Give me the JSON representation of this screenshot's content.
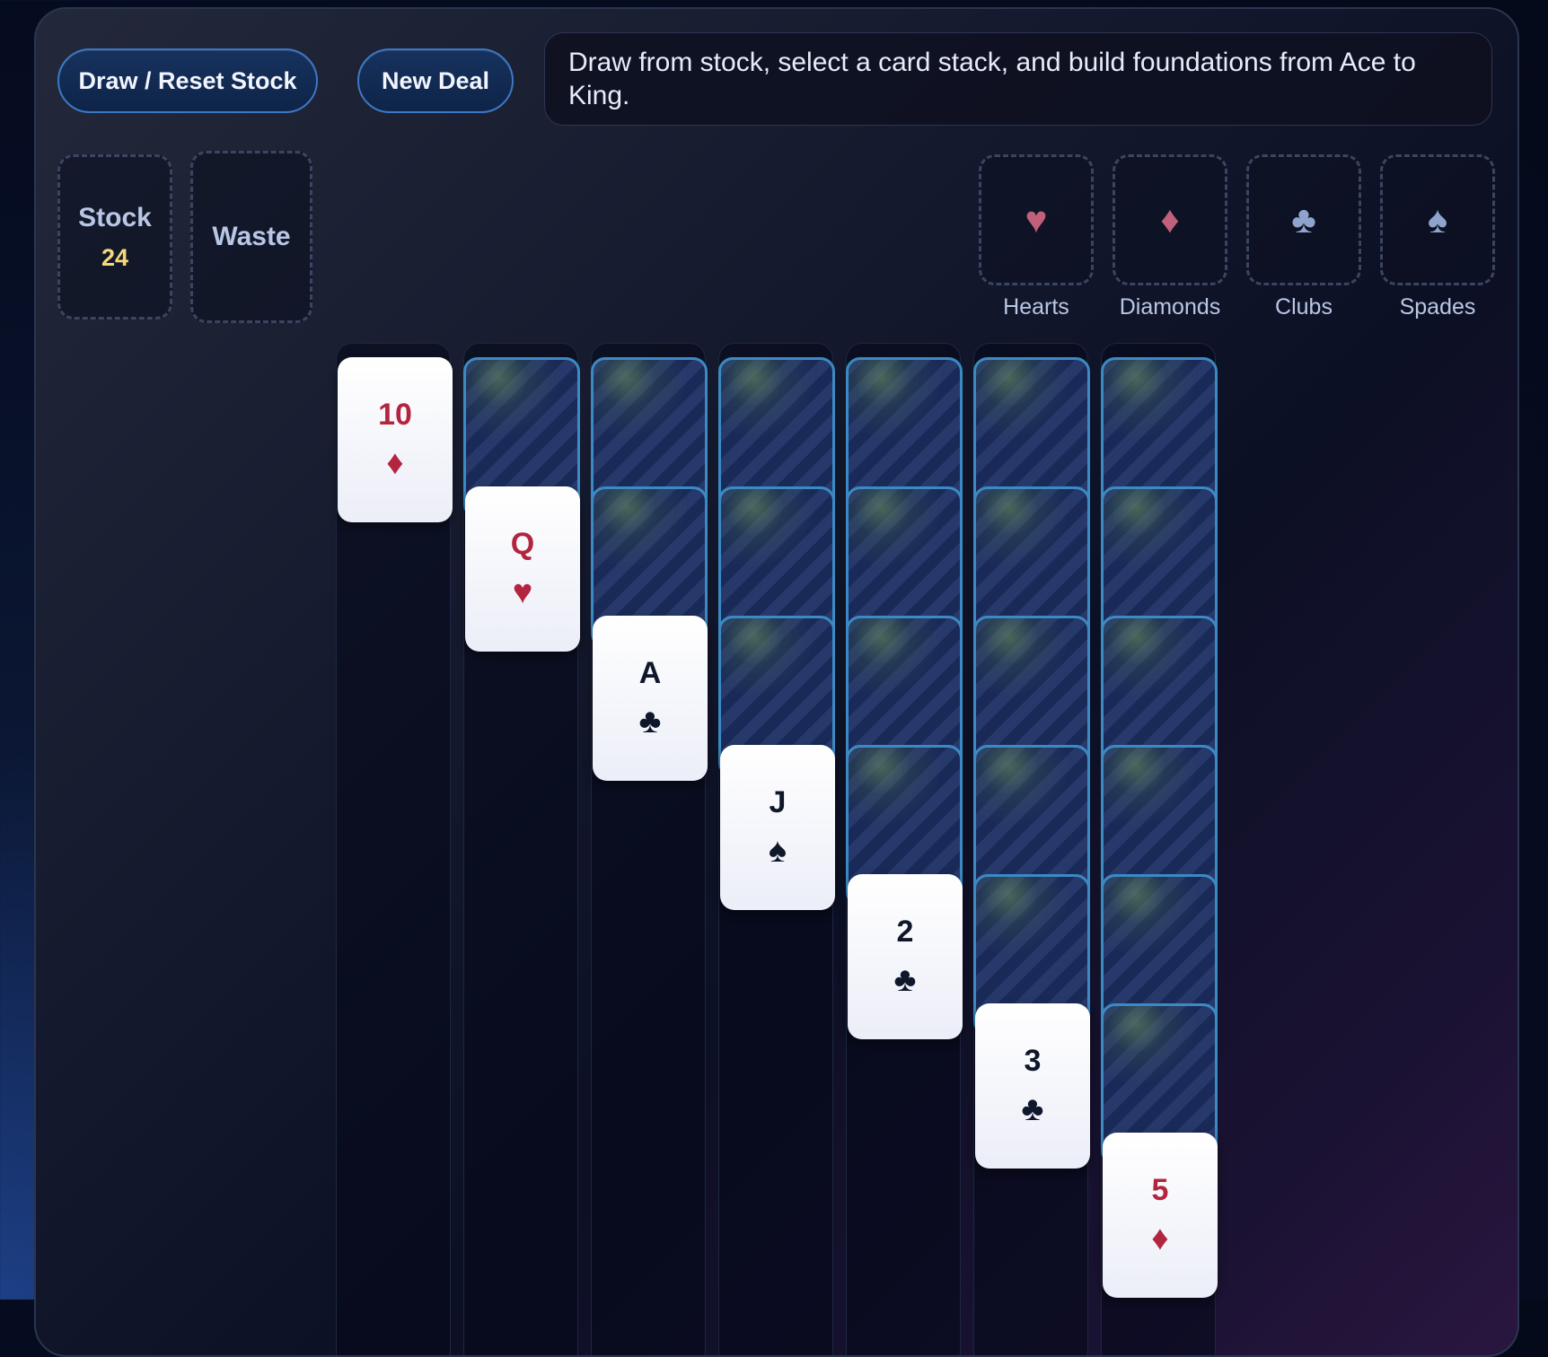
{
  "toolbar": {
    "draw_label": "Draw / Reset Stock",
    "new_deal_label": "New Deal"
  },
  "message": "Draw from stock, select a card stack, and build foundations from Ace to King.",
  "stock": {
    "label": "Stock",
    "count": "24"
  },
  "waste": {
    "label": "Waste"
  },
  "foundations": [
    {
      "name": "Hearts",
      "symbol": "♥",
      "color": "#c0607a",
      "icon": "heart-icon"
    },
    {
      "name": "Diamonds",
      "symbol": "♦",
      "color": "#c0607a",
      "icon": "diamond-icon"
    },
    {
      "name": "Clubs",
      "symbol": "♣",
      "color": "#8fa4cc",
      "icon": "club-icon"
    },
    {
      "name": "Spades",
      "symbol": "♠",
      "color": "#8fa4cc",
      "icon": "spade-icon"
    }
  ],
  "tableau": [
    {
      "face_down": 0,
      "top": {
        "rank": "10",
        "suit": "♦",
        "color": "red"
      }
    },
    {
      "face_down": 1,
      "top": {
        "rank": "Q",
        "suit": "♥",
        "color": "red"
      }
    },
    {
      "face_down": 2,
      "top": {
        "rank": "A",
        "suit": "♣",
        "color": "black"
      }
    },
    {
      "face_down": 3,
      "top": {
        "rank": "J",
        "suit": "♠",
        "color": "black"
      }
    },
    {
      "face_down": 4,
      "top": {
        "rank": "2",
        "suit": "♣",
        "color": "black"
      }
    },
    {
      "face_down": 5,
      "top": {
        "rank": "3",
        "suit": "♣",
        "color": "black"
      }
    },
    {
      "face_down": 6,
      "top": {
        "rank": "5",
        "suit": "♦",
        "color": "red"
      }
    }
  ],
  "colors": {
    "card_red": "#b3253e",
    "card_black": "#0f172a",
    "button_border": "#3d78c4",
    "stock_count": "#f5d87a"
  }
}
